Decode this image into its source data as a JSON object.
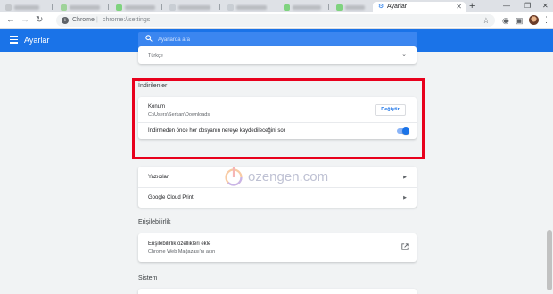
{
  "browser": {
    "active_tab_title": "Ayarlar",
    "omnibox_chip": "Chrome",
    "omnibox_url": "chrome://settings",
    "icons": [
      "back-icon",
      "forward-icon",
      "reload-icon",
      "info-icon",
      "star-icon",
      "extension-icon",
      "cast-icon",
      "menu-icon"
    ]
  },
  "header": {
    "title": "Ayarlar",
    "search_placeholder": "Ayarlarda ara"
  },
  "language_card": {
    "value": "Türkçe"
  },
  "downloads": {
    "section_title": "İndirilenler",
    "location_label": "Konum",
    "location_path": "C:\\Users\\Serkan\\Downloads",
    "change_button": "Değiştir",
    "ask_label": "İndirmeden önce her dosyanın nereye kaydedileceğini sor",
    "ask_enabled": true
  },
  "printing": {
    "printers_label": "Yazıcılar",
    "cloud_print_label": "Google Cloud Print"
  },
  "accessibility": {
    "section_title": "Erişilebilirlik",
    "add_label": "Erişilebilirlik özellikleri ekle",
    "add_sub": "Chrome Web Mağazası'nı açın"
  },
  "system": {
    "section_title": "Sistem"
  },
  "watermark": {
    "text": "ozengen.com"
  },
  "colors": {
    "accent": "#1a73e8",
    "highlight": "#e8001c"
  }
}
